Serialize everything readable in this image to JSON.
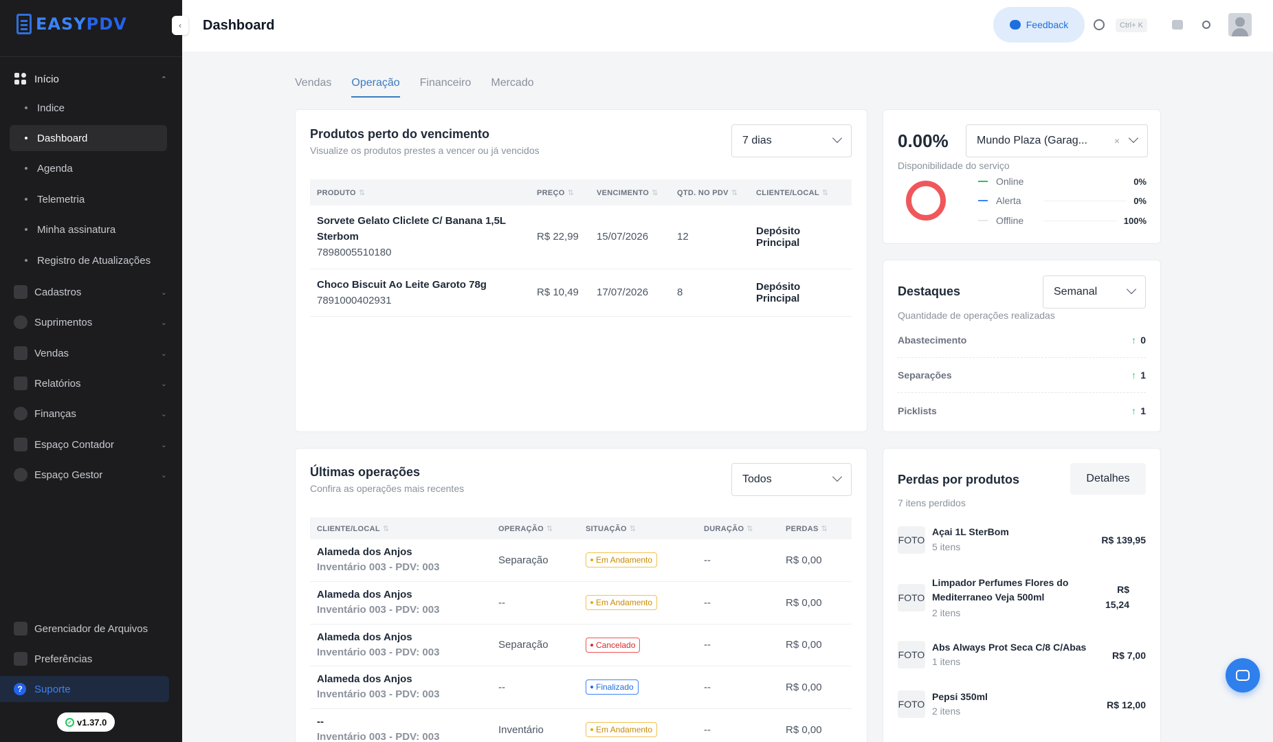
{
  "app": {
    "logo_text_easy": "EASY",
    "logo_text_pdv": "PDV",
    "version": "v1.37.0",
    "brand_color": "#2f6fdc"
  },
  "sidebar": {
    "group_inicio": {
      "label": "Início",
      "items": [
        {
          "label": "Indice"
        },
        {
          "label": "Dashboard"
        },
        {
          "label": "Agenda"
        },
        {
          "label": "Telemetria"
        },
        {
          "label": "Minha assinatura"
        },
        {
          "label": "Registro de Atualizações"
        }
      ]
    },
    "menu": [
      {
        "label": "Cadastros"
      },
      {
        "label": "Suprimentos"
      },
      {
        "label": "Vendas"
      },
      {
        "label": "Relatórios"
      },
      {
        "label": "Finanças"
      },
      {
        "label": "Espaço Contador"
      },
      {
        "label": "Espaço Gestor"
      }
    ],
    "bottom": [
      {
        "label": "Gerenciador de Arquivos"
      },
      {
        "label": "Preferências"
      }
    ],
    "support_label": "Suporte"
  },
  "topbar": {
    "title": "Dashboard",
    "feedback_label": "Feedback",
    "shortcut": "Ctrl+ K"
  },
  "tabs": [
    {
      "label": "Vendas"
    },
    {
      "label": "Operação"
    },
    {
      "label": "Financeiro"
    },
    {
      "label": "Mercado"
    }
  ],
  "expiring": {
    "title": "Produtos perto do vencimento",
    "subtitle": "Visualize os produtos prestes a vencer ou já vencidos",
    "filter_value": "7 dias",
    "columns": [
      "PRODUTO",
      "PREÇO",
      "VENCIMENTO",
      "QTD. NO PDV",
      "CLIENTE/LOCAL"
    ],
    "rows": [
      {
        "name": "Sorvete Gelato Cliclete C/ Banana 1,5L Sterbom",
        "code": "7898005510180",
        "price": "R$ 22,99",
        "expiry": "15/07/2026",
        "qty": "12",
        "location": "Depósito Principal"
      },
      {
        "name": "Choco Biscuit Ao Leite Garoto 78g",
        "code": "7891000402931",
        "price": "R$ 10,49",
        "expiry": "17/07/2026",
        "qty": "8",
        "location": "Depósito Principal"
      }
    ]
  },
  "availability": {
    "percent": "0.00%",
    "label": "Disponibilidade do serviço",
    "location_value": "Mundo Plaza (Garag...",
    "legend": [
      {
        "label": "Online",
        "value": "0%",
        "color": "#22c55e"
      },
      {
        "label": "Alerta",
        "value": "0%",
        "color": "#3b82f6"
      },
      {
        "label": "Offline",
        "value": "100%",
        "color": "#e5e7eb"
      }
    ],
    "ring_color": "#f0575b"
  },
  "highlights": {
    "title": "Destaques",
    "subtitle": "Quantidade de operações realizadas",
    "period_value": "Semanal",
    "rows": [
      {
        "label": "Abastecimento",
        "value": "0"
      },
      {
        "label": "Separações",
        "value": "1"
      },
      {
        "label": "Picklists",
        "value": "1"
      }
    ]
  },
  "operations": {
    "title": "Últimas operações",
    "subtitle": "Confira as operações mais recentes",
    "filter_value": "Todos",
    "columns": [
      "CLIENTE/LOCAL",
      "OPERAÇÃO",
      "SITUAÇÃO",
      "DURAÇÃO",
      "PERDAS"
    ],
    "rows": [
      {
        "client": "Alameda dos Anjos",
        "detail": "Inventário 003 - PDV: 003",
        "operation": "Separação",
        "status": "Em Andamento",
        "status_kind": "warn",
        "duration": "--",
        "losses": "R$ 0,00"
      },
      {
        "client": "Alameda dos Anjos",
        "detail": "Inventário 003 - PDV: 003",
        "operation": "--",
        "status": "Em Andamento",
        "status_kind": "warn",
        "duration": "--",
        "losses": "R$ 0,00"
      },
      {
        "client": "Alameda dos Anjos",
        "detail": "Inventário 003 - PDV: 003",
        "operation": "Separação",
        "status": "Cancelado",
        "status_kind": "danger",
        "duration": "--",
        "losses": "R$ 0,00"
      },
      {
        "client": "Alameda dos Anjos",
        "detail": "Inventário 003 - PDV: 003",
        "operation": "--",
        "status": "Finalizado",
        "status_kind": "info",
        "duration": "--",
        "losses": "R$ 0,00"
      },
      {
        "client": "--",
        "detail": "Inventário 003 - PDV: 003",
        "operation": "Inventário",
        "status": "Em Andamento",
        "status_kind": "warn",
        "duration": "--",
        "losses": "R$ 0,00"
      }
    ]
  },
  "losses": {
    "title": "Perdas por produtos",
    "subtitle": "7 itens perdidos",
    "details_label": "Detalhes",
    "photo_label": "FOTO",
    "items": [
      {
        "name": "Açai 1L SterBom",
        "qty": "5 itens",
        "value": "R$ 139,95"
      },
      {
        "name": "Limpador Perfumes Flores do Mediterraneo Veja 500ml",
        "qty": "2 itens",
        "value": "R$ 15,24"
      },
      {
        "name": "Abs Always Prot Seca C/8 C/Abas",
        "qty": "1 itens",
        "value": "R$ 7,00"
      },
      {
        "name": "Pepsi 350ml",
        "qty": "2 itens",
        "value": "R$ 12,00"
      }
    ]
  }
}
